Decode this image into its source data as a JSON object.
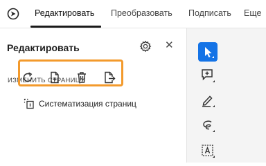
{
  "topnav": {
    "tabs": [
      {
        "label": "Редактировать",
        "active": true
      },
      {
        "label": "Преобразовать",
        "active": false
      },
      {
        "label": "Подписать",
        "active": false
      },
      {
        "label": "Еще",
        "active": false
      }
    ]
  },
  "panel": {
    "title": "Редактировать",
    "section_title": "ИЗМЕНИТЬ СТРАНИЦУ",
    "tools": [
      {
        "icon": "rotate-icon"
      },
      {
        "icon": "insert-page-icon"
      },
      {
        "icon": "delete-icon"
      },
      {
        "icon": "extract-page-icon"
      }
    ],
    "organize_label": "Систематизация страниц"
  },
  "rail": {
    "tools": [
      {
        "icon": "select-cursor-icon",
        "selected": true
      },
      {
        "icon": "add-comment-icon",
        "selected": false
      },
      {
        "icon": "draw-pen-icon",
        "selected": false
      },
      {
        "icon": "freehand-curve-icon",
        "selected": false
      },
      {
        "icon": "text-box-icon",
        "selected": false
      }
    ]
  },
  "colors": {
    "accent_blue": "#1473e6",
    "highlight_orange": "#f39a2c",
    "rail_bg": "#f4f4f4"
  }
}
